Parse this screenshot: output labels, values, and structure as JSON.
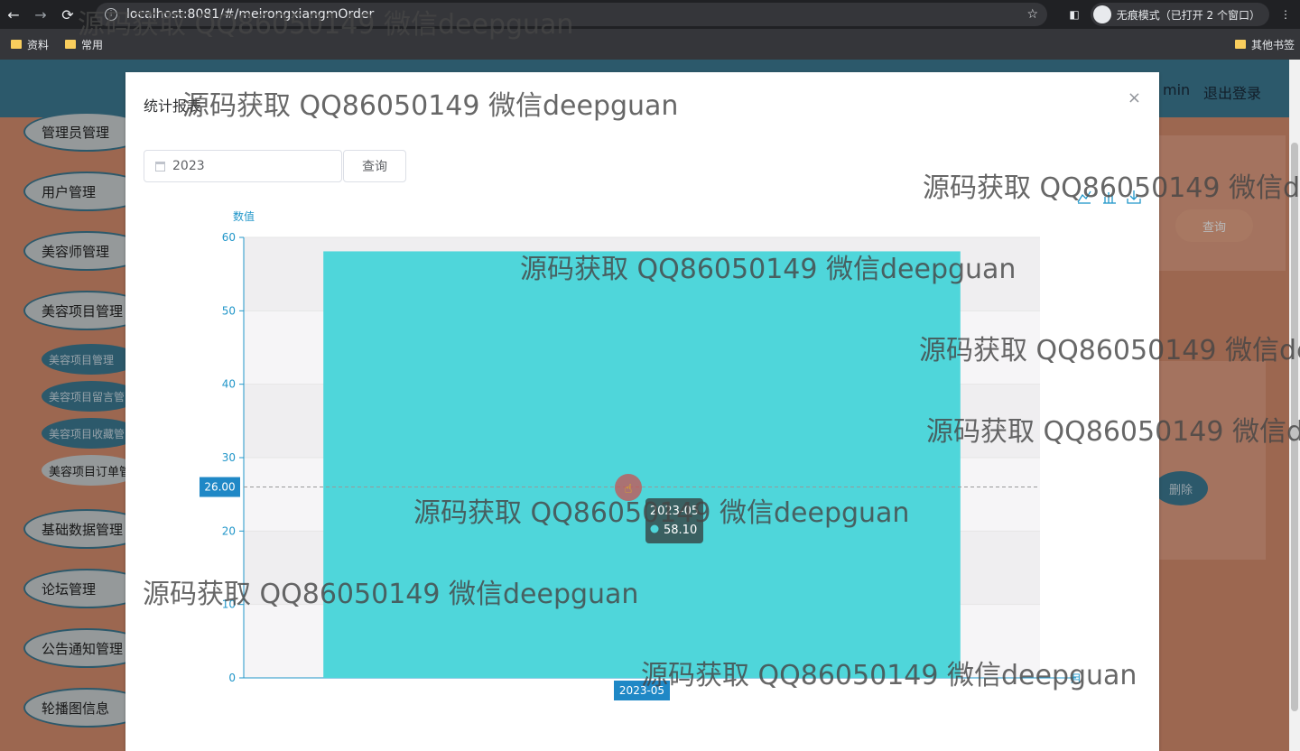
{
  "browser": {
    "url": "localhost:8081/#/meirongxiangmOrder",
    "incognito_label": "无痕模式（已打开 2 个窗口）",
    "bookmarks": [
      "资料",
      "常用"
    ],
    "other_bookmarks": "其他书签"
  },
  "header": {
    "user": "min",
    "logout": "退出登录"
  },
  "sidebar": {
    "items": [
      "管理员管理",
      "用户管理",
      "美容师管理",
      "美容项目管理",
      "基础数据管理",
      "论坛管理",
      "公告通知管理",
      "轮播图信息"
    ],
    "sub_items": [
      "美容项目管理",
      "美容项目留言管",
      "美容项目收藏管",
      "美容项目订单管"
    ]
  },
  "background": {
    "query_button": "查询",
    "delete_button": "删除"
  },
  "modal": {
    "title": "统计报表",
    "date_value": "2023",
    "query_button": "查询",
    "close_icon": "×"
  },
  "chart_data": {
    "type": "bar",
    "ylabel": "数值",
    "xlabel": "月",
    "categories": [
      "2023-05"
    ],
    "values": [
      58.1
    ],
    "ylim": [
      0,
      60
    ],
    "yticks": [
      0,
      10,
      20,
      30,
      40,
      50,
      60
    ],
    "crosshair_value": "26.00",
    "x_pointer_label": "2023-05",
    "tooltip": {
      "category": "2023-05",
      "value": "58.10"
    },
    "bar_color": "#4fd6da",
    "axis_color": "#2196c9",
    "toolbox": [
      "line-icon",
      "bar-icon",
      "download-icon"
    ]
  },
  "watermark": "源码获取 QQ86050149 微信deepguan"
}
